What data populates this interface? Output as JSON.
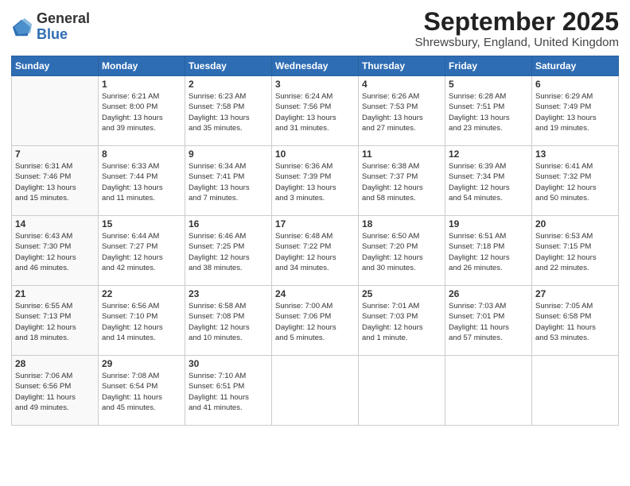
{
  "logo": {
    "general": "General",
    "blue": "Blue"
  },
  "title": "September 2025",
  "subtitle": "Shrewsbury, England, United Kingdom",
  "days_header": [
    "Sunday",
    "Monday",
    "Tuesday",
    "Wednesday",
    "Thursday",
    "Friday",
    "Saturday"
  ],
  "weeks": [
    [
      {
        "day": "",
        "info": ""
      },
      {
        "day": "1",
        "info": "Sunrise: 6:21 AM\nSunset: 8:00 PM\nDaylight: 13 hours\nand 39 minutes."
      },
      {
        "day": "2",
        "info": "Sunrise: 6:23 AM\nSunset: 7:58 PM\nDaylight: 13 hours\nand 35 minutes."
      },
      {
        "day": "3",
        "info": "Sunrise: 6:24 AM\nSunset: 7:56 PM\nDaylight: 13 hours\nand 31 minutes."
      },
      {
        "day": "4",
        "info": "Sunrise: 6:26 AM\nSunset: 7:53 PM\nDaylight: 13 hours\nand 27 minutes."
      },
      {
        "day": "5",
        "info": "Sunrise: 6:28 AM\nSunset: 7:51 PM\nDaylight: 13 hours\nand 23 minutes."
      },
      {
        "day": "6",
        "info": "Sunrise: 6:29 AM\nSunset: 7:49 PM\nDaylight: 13 hours\nand 19 minutes."
      }
    ],
    [
      {
        "day": "7",
        "info": "Sunrise: 6:31 AM\nSunset: 7:46 PM\nDaylight: 13 hours\nand 15 minutes."
      },
      {
        "day": "8",
        "info": "Sunrise: 6:33 AM\nSunset: 7:44 PM\nDaylight: 13 hours\nand 11 minutes."
      },
      {
        "day": "9",
        "info": "Sunrise: 6:34 AM\nSunset: 7:41 PM\nDaylight: 13 hours\nand 7 minutes."
      },
      {
        "day": "10",
        "info": "Sunrise: 6:36 AM\nSunset: 7:39 PM\nDaylight: 13 hours\nand 3 minutes."
      },
      {
        "day": "11",
        "info": "Sunrise: 6:38 AM\nSunset: 7:37 PM\nDaylight: 12 hours\nand 58 minutes."
      },
      {
        "day": "12",
        "info": "Sunrise: 6:39 AM\nSunset: 7:34 PM\nDaylight: 12 hours\nand 54 minutes."
      },
      {
        "day": "13",
        "info": "Sunrise: 6:41 AM\nSunset: 7:32 PM\nDaylight: 12 hours\nand 50 minutes."
      }
    ],
    [
      {
        "day": "14",
        "info": "Sunrise: 6:43 AM\nSunset: 7:30 PM\nDaylight: 12 hours\nand 46 minutes."
      },
      {
        "day": "15",
        "info": "Sunrise: 6:44 AM\nSunset: 7:27 PM\nDaylight: 12 hours\nand 42 minutes."
      },
      {
        "day": "16",
        "info": "Sunrise: 6:46 AM\nSunset: 7:25 PM\nDaylight: 12 hours\nand 38 minutes."
      },
      {
        "day": "17",
        "info": "Sunrise: 6:48 AM\nSunset: 7:22 PM\nDaylight: 12 hours\nand 34 minutes."
      },
      {
        "day": "18",
        "info": "Sunrise: 6:50 AM\nSunset: 7:20 PM\nDaylight: 12 hours\nand 30 minutes."
      },
      {
        "day": "19",
        "info": "Sunrise: 6:51 AM\nSunset: 7:18 PM\nDaylight: 12 hours\nand 26 minutes."
      },
      {
        "day": "20",
        "info": "Sunrise: 6:53 AM\nSunset: 7:15 PM\nDaylight: 12 hours\nand 22 minutes."
      }
    ],
    [
      {
        "day": "21",
        "info": "Sunrise: 6:55 AM\nSunset: 7:13 PM\nDaylight: 12 hours\nand 18 minutes."
      },
      {
        "day": "22",
        "info": "Sunrise: 6:56 AM\nSunset: 7:10 PM\nDaylight: 12 hours\nand 14 minutes."
      },
      {
        "day": "23",
        "info": "Sunrise: 6:58 AM\nSunset: 7:08 PM\nDaylight: 12 hours\nand 10 minutes."
      },
      {
        "day": "24",
        "info": "Sunrise: 7:00 AM\nSunset: 7:06 PM\nDaylight: 12 hours\nand 5 minutes."
      },
      {
        "day": "25",
        "info": "Sunrise: 7:01 AM\nSunset: 7:03 PM\nDaylight: 12 hours\nand 1 minute."
      },
      {
        "day": "26",
        "info": "Sunrise: 7:03 AM\nSunset: 7:01 PM\nDaylight: 11 hours\nand 57 minutes."
      },
      {
        "day": "27",
        "info": "Sunrise: 7:05 AM\nSunset: 6:58 PM\nDaylight: 11 hours\nand 53 minutes."
      }
    ],
    [
      {
        "day": "28",
        "info": "Sunrise: 7:06 AM\nSunset: 6:56 PM\nDaylight: 11 hours\nand 49 minutes."
      },
      {
        "day": "29",
        "info": "Sunrise: 7:08 AM\nSunset: 6:54 PM\nDaylight: 11 hours\nand 45 minutes."
      },
      {
        "day": "30",
        "info": "Sunrise: 7:10 AM\nSunset: 6:51 PM\nDaylight: 11 hours\nand 41 minutes."
      },
      {
        "day": "",
        "info": ""
      },
      {
        "day": "",
        "info": ""
      },
      {
        "day": "",
        "info": ""
      },
      {
        "day": "",
        "info": ""
      }
    ]
  ]
}
